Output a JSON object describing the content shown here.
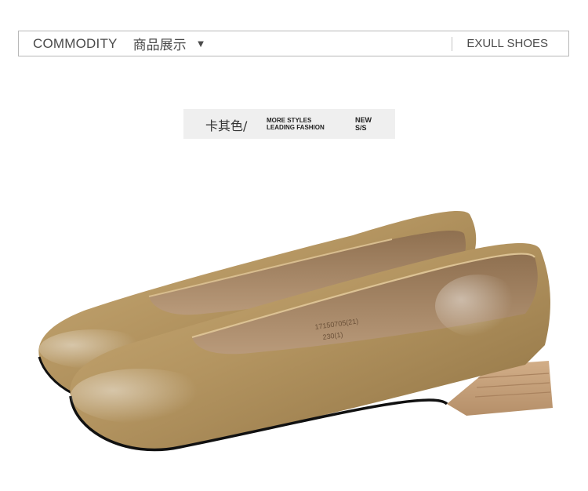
{
  "header": {
    "commodity": "COMMODITY",
    "commodity_zh": "商品展示",
    "arrow": "▼",
    "brand": "EXULL SHOES"
  },
  "color_tag": {
    "name": "卡其色/",
    "slogan_line1": "MORE STYLES",
    "slogan_line2": "LEADING FASHION",
    "season_line1": "NEW",
    "season_line2": "S/S"
  },
  "product": {
    "insole_line1": "17150705(21)",
    "insole_line2": "230(1)",
    "colors": {
      "leather": "#b39460",
      "leather_dark": "#8e7142",
      "lining": "#a5876a",
      "heel": "#c7a27c",
      "sole": "#1a1a1a"
    }
  }
}
